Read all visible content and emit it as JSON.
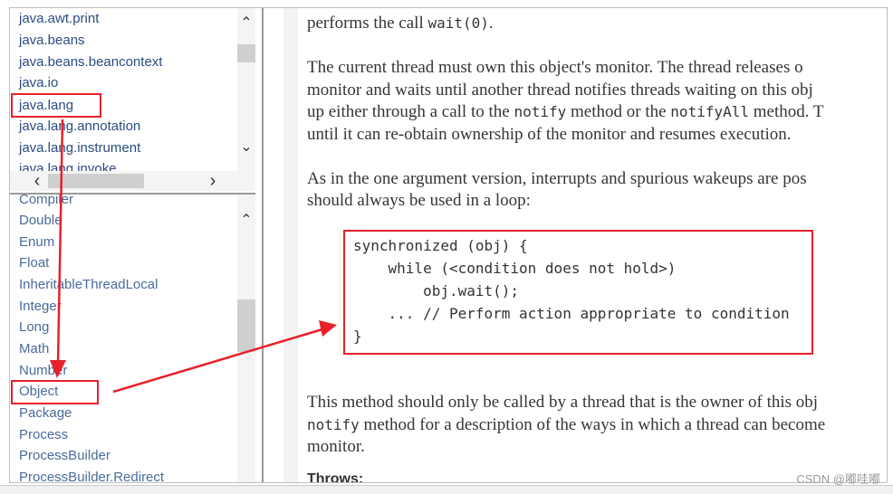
{
  "package_list": [
    "java.awt.print",
    "java.beans",
    "java.beans.beancontext",
    "java.io",
    "java.lang",
    "java.lang.annotation",
    "java.lang.instrument",
    "java.lang.invoke"
  ],
  "class_list": [
    "Compiler",
    "Double",
    "Enum",
    "Float",
    "InheritableThreadLocal",
    "Integer",
    "Long",
    "Math",
    "Number",
    "Object",
    "Package",
    "Process",
    "ProcessBuilder",
    "ProcessBuilder.Redirect"
  ],
  "highlighted": {
    "package": "java.lang",
    "class": "Object"
  },
  "doc": {
    "p1_text": "performs the call ",
    "p1_code": "wait(0)",
    "p1_end": ".",
    "p2_l1": "The current thread must own this object's monitor. The thread releases o",
    "p2_l2": "monitor and waits until another thread notifies threads waiting on this obj",
    "p2_l3a": "up either through a call to the ",
    "p2_l3b": "notify",
    "p2_l3c": " method or the ",
    "p2_l3d": "notifyAll",
    "p2_l3e": " method. T",
    "p2_l4": "until it can re-obtain ownership of the monitor and resumes execution.",
    "p3_l1": "As in the one argument version, interrupts and spurious wakeups are pos",
    "p3_l2": "should always be used in a loop:",
    "code": [
      "synchronized (obj) {",
      "    while (<condition does not hold>)",
      "        obj.wait();",
      "    ... // Perform action appropriate to condition",
      "}"
    ],
    "p4_l1": "This method should only be called by a thread that is the owner of this obj",
    "p4_l2a": "notify",
    "p4_l2b": " method for a description of the ways in which a thread can become",
    "p4_l3": "monitor.",
    "throws": "Throws:"
  },
  "watermark": "CSDN @嘟哇嘟",
  "colors": {
    "annotation": "#e8202a",
    "link": "#2b4c80"
  }
}
